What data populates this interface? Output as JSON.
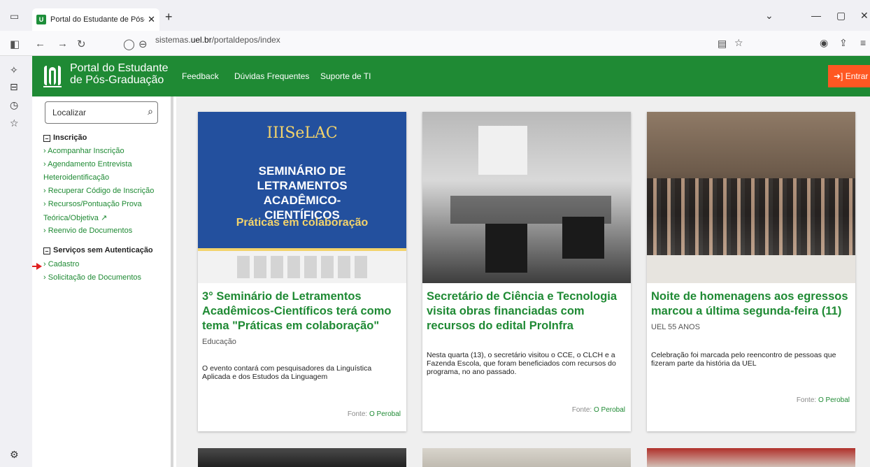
{
  "browser": {
    "tab_title": "Portal do Estudante de Pós-Gra",
    "favicon_text": "U",
    "url_prefix": "sistemas.",
    "url_domain": "uel.br",
    "url_path": "/portaldepos/index"
  },
  "header": {
    "brand_line1": "Portal do Estudante",
    "brand_line2": "de Pós-Graduação",
    "nav": [
      "Feedback",
      "Dúvidas Frequentes",
      "Suporte de TI"
    ],
    "login_label": "Entrar",
    "color": "#1f8a34",
    "login_color": "#ff5722"
  },
  "sidebar": {
    "search_placeholder": "Localizar",
    "section1_title": "Inscrição",
    "section1_items": [
      "Acompanhar Inscrição",
      "Agendamento Entrevista",
      "Heteroidentificação",
      "Recuperar Código de Inscrição",
      "Recursos/Pontuação Prova",
      "Teórica/Objetiva",
      "Reenvio de Documentos"
    ],
    "section2_title": "Serviços sem Autenticação",
    "section2_items": [
      "Cadastro",
      "Solicitação de Documentos"
    ]
  },
  "cards": [
    {
      "title": "3° Seminário de Letramentos Acadêmicos-Científicos terá como tema \"Práticas em colaboração\"",
      "category": "Educação",
      "description": "O evento contará com pesquisadores da Linguística Aplicada e dos Estudos da Linguagem",
      "source_label": "Fonte:",
      "source": "O Perobal",
      "poster_brand": "IIISeLAC",
      "poster_title": "SEMINÁRIO DE LETRAMENTOS ACADÊMICO-CIENTÍFICOS",
      "poster_subtitle": "Práticas em colaboração"
    },
    {
      "title": "Secretário de Ciência e Tecnologia visita obras financiadas com recursos do edital ProInfra",
      "category": "",
      "description": "Nesta quarta (13), o secretário visitou o CCE, o CLCH e a Fazenda Escola, que foram beneficiados com recursos do programa, no ano passado.",
      "source_label": "Fonte:",
      "source": "O Perobal"
    },
    {
      "title": "Noite de homenagens aos egressos marcou a última segunda-feira (11)",
      "category": "UEL 55 ANOS",
      "description": "Celebração foi marcada pelo reencontro de pessoas que fizeram parte da história da UEL",
      "source_label": "Fonte:",
      "source": "O Perobal"
    }
  ]
}
